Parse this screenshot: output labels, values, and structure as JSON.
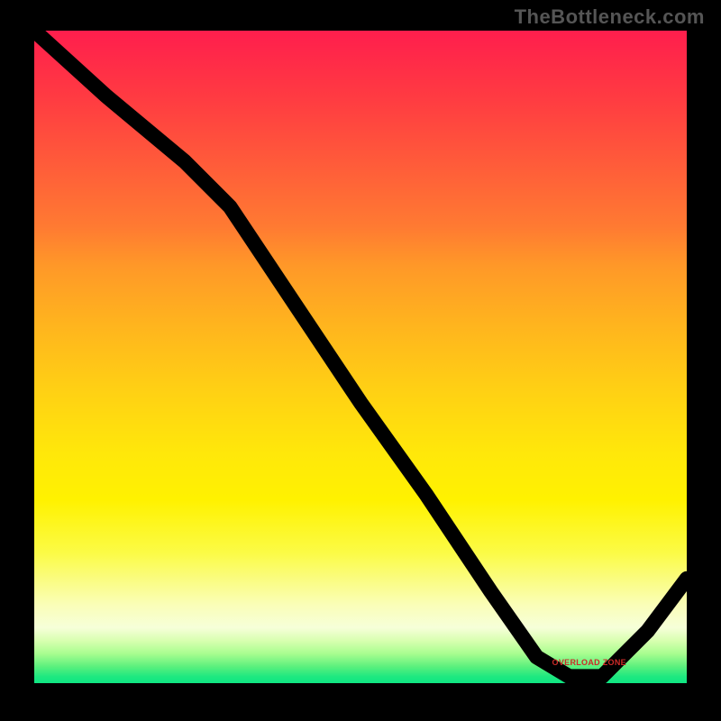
{
  "watermark": "TheBottleneck.com",
  "annotation_label": "OVERLOAD ZONE",
  "chart_data": {
    "type": "line",
    "title": "",
    "xlabel": "",
    "ylabel": "",
    "xlim": [
      0,
      100
    ],
    "ylim": [
      0,
      100
    ],
    "series": [
      {
        "name": "curve",
        "x": [
          0,
          11,
          23,
          30,
          40,
          50,
          60,
          70,
          77,
          82,
          87,
          94,
          100
        ],
        "values": [
          100,
          90,
          80,
          73,
          58,
          43,
          29,
          14,
          4,
          1,
          1,
          8,
          16
        ]
      }
    ],
    "annotation": {
      "x": 83.5,
      "y": 3
    },
    "gradient_stops": [
      {
        "pct": 0,
        "color": "#ff1e4d"
      },
      {
        "pct": 10,
        "color": "#ff3a42"
      },
      {
        "pct": 20,
        "color": "#ff5a3a"
      },
      {
        "pct": 30,
        "color": "#ff7a32"
      },
      {
        "pct": 36,
        "color": "#ff9828"
      },
      {
        "pct": 45,
        "color": "#ffb41e"
      },
      {
        "pct": 55,
        "color": "#ffd014"
      },
      {
        "pct": 65,
        "color": "#ffe80a"
      },
      {
        "pct": 72,
        "color": "#fff200"
      },
      {
        "pct": 80,
        "color": "#fbfb46"
      },
      {
        "pct": 88,
        "color": "#fafeb8"
      },
      {
        "pct": 91.5,
        "color": "#f6ffd9"
      },
      {
        "pct": 93.5,
        "color": "#d8ffb0"
      },
      {
        "pct": 95.5,
        "color": "#a8fd8f"
      },
      {
        "pct": 97.5,
        "color": "#5af07d"
      },
      {
        "pct": 99,
        "color": "#1ee880"
      },
      {
        "pct": 100,
        "color": "#0fe683"
      }
    ]
  }
}
